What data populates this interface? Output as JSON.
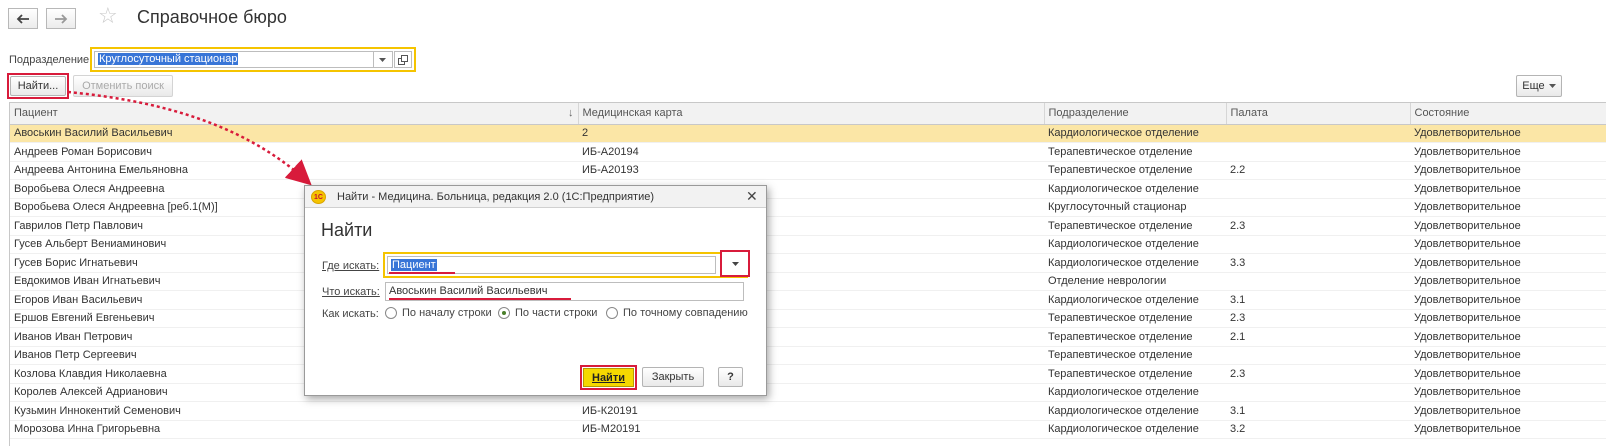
{
  "title": "Справочное бюро",
  "filter": {
    "label": "Подразделение:",
    "value": "Круглосуточный стационар"
  },
  "toolbar": {
    "find": "Найти...",
    "cancel_find": "Отменить поиск",
    "more": "Еще"
  },
  "columns": [
    "Пациент",
    "Медицинская карта",
    "Подразделение",
    "Палата",
    "Состояние"
  ],
  "sort_arrow": "↓",
  "rows": [
    {
      "patient": "Авоськин Василий Васильевич",
      "card": "2",
      "dept": "Кардиологическое отделение",
      "ward": "",
      "state": "Удовлетворительное"
    },
    {
      "patient": "Андреев Роман Борисович",
      "card": "ИБ-А20194",
      "dept": "Терапевтическое отделение",
      "ward": "",
      "state": "Удовлетворительное"
    },
    {
      "patient": "Андреева Антонина Емельяновна",
      "card": "ИБ-А20193",
      "dept": "Терапевтическое отделение",
      "ward": "2.2",
      "state": "Удовлетворительное"
    },
    {
      "patient": "Воробьева Олеся Андреевна",
      "card": "",
      "dept": "Кардиологическое отделение",
      "ward": "",
      "state": "Удовлетворительное"
    },
    {
      "patient": "Воробьева Олеся Андреевна [реб.1(М)]",
      "card": "",
      "dept": "Круглосуточный стационар",
      "ward": "",
      "state": "Удовлетворительное"
    },
    {
      "patient": "Гаврилов Петр Павлович",
      "card": "",
      "dept": "Терапевтическое отделение",
      "ward": "2.3",
      "state": "Удовлетворительное"
    },
    {
      "patient": "Гусев Альберт Вениаминович",
      "card": "",
      "dept": "Кардиологическое отделение",
      "ward": "",
      "state": "Удовлетворительное"
    },
    {
      "patient": "Гусев Борис Игнатьевич",
      "card": "",
      "dept": "Кардиологическое отделение",
      "ward": "3.3",
      "state": "Удовлетворительное"
    },
    {
      "patient": "Евдокимов Иван Игнатьевич",
      "card": "",
      "dept": "Отделение неврологии",
      "ward": "",
      "state": "Удовлетворительное"
    },
    {
      "patient": "Егоров Иван Васильевич",
      "card": "",
      "dept": "Кардиологическое отделение",
      "ward": "3.1",
      "state": "Удовлетворительное"
    },
    {
      "patient": "Ершов Евгений Евгеньевич",
      "card": "",
      "dept": "Терапевтическое отделение",
      "ward": "2.3",
      "state": "Удовлетворительное"
    },
    {
      "patient": "Иванов Иван Петрович",
      "card": "",
      "dept": "Терапевтическое отделение",
      "ward": "2.1",
      "state": "Удовлетворительное"
    },
    {
      "patient": "Иванов Петр Сергеевич",
      "card": "",
      "dept": "Терапевтическое отделение",
      "ward": "",
      "state": "Удовлетворительное"
    },
    {
      "patient": "Козлова Клавдия Николаевна",
      "card": "",
      "dept": "Терапевтическое отделение",
      "ward": "2.3",
      "state": "Удовлетворительное"
    },
    {
      "patient": "Королев Алексей Адрианович",
      "card": "",
      "dept": "Кардиологическое отделение",
      "ward": "",
      "state": "Удовлетворительное"
    },
    {
      "patient": "Кузьмин Иннокентий Семенович",
      "card": "ИБ-К20191",
      "dept": "Кардиологическое отделение",
      "ward": "3.1",
      "state": "Удовлетворительное"
    },
    {
      "patient": "Морозова Инна Григорьевна",
      "card": "ИБ-М20191",
      "dept": "Кардиологическое отделение",
      "ward": "3.2",
      "state": "Удовлетворительное"
    }
  ],
  "dialog": {
    "title": "Найти - Медицина. Больница, редакция 2.0  (1С:Предприятие)",
    "logo": "1С",
    "heading": "Найти",
    "where_label": "Где искать:",
    "where_value": "Пациент",
    "what_label": "Что искать:",
    "what_value": "Авоськин Василий Васильевич",
    "how_label": "Как искать:",
    "options": [
      "По началу строки",
      "По части строки",
      "По точному совпадению"
    ],
    "selected_option": 1,
    "find_button": "Найти",
    "close_button": "Закрыть",
    "help_button": "?"
  },
  "colors": {
    "accent_yellow": "#f5c400",
    "highlight_red": "#d81b3b",
    "selected_row": "#fbe6a6",
    "selection_blue": "#3875d7"
  }
}
